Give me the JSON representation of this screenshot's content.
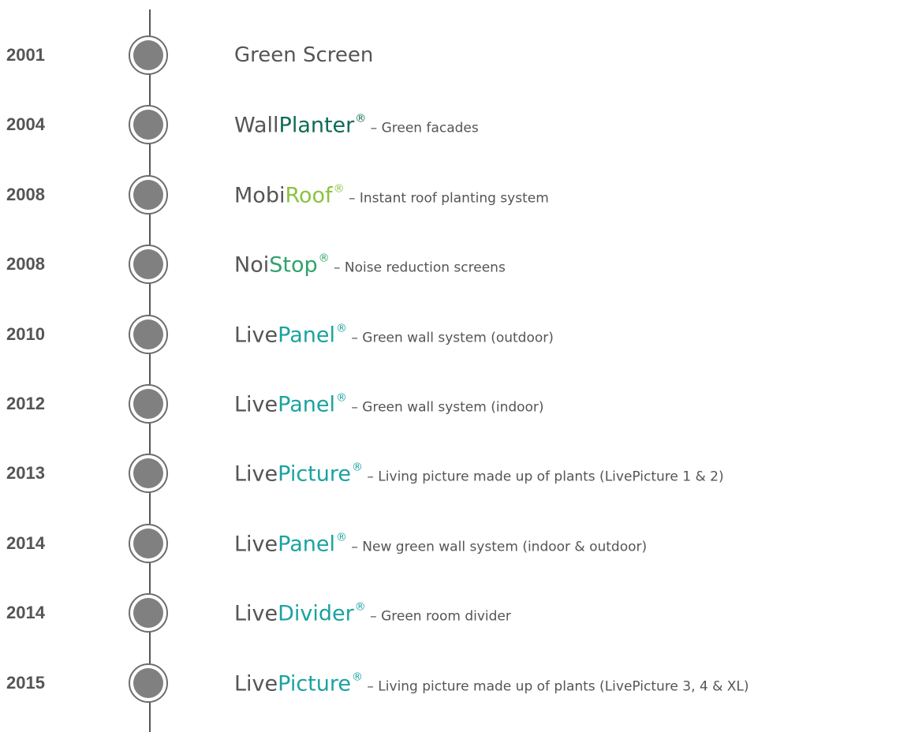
{
  "colors": {
    "dark_green": "#0e6c54",
    "lime_green": "#8ac43f",
    "green": "#2ea36a",
    "teal": "#1aa3a0",
    "gray_text": "#555555",
    "node_gray": "#808080"
  },
  "timeline": [
    {
      "year": "2001",
      "base": "Green Screen",
      "accent": "",
      "accent_color": "",
      "reg": "",
      "desc": ""
    },
    {
      "year": "2004",
      "base": "Wall",
      "accent": "Planter",
      "accent_color": "#0e6c54",
      "reg": "®",
      "desc": " – Green facades"
    },
    {
      "year": "2008",
      "base": "Mobi",
      "accent": "Roof",
      "accent_color": "#8ac43f",
      "reg": "®",
      "desc": " – Instant roof planting system"
    },
    {
      "year": "2008",
      "base": "Noi",
      "accent": "Stop",
      "accent_color": "#2ea36a",
      "reg": "®",
      "desc": " – Noise reduction screens"
    },
    {
      "year": "2010",
      "base": "Live",
      "accent": "Panel",
      "accent_color": "#1aa3a0",
      "reg": "®",
      "desc": " – Green wall system (outdoor)"
    },
    {
      "year": "2012",
      "base": "Live",
      "accent": "Panel",
      "accent_color": "#1aa3a0",
      "reg": "®",
      "desc": " – Green wall system (indoor)"
    },
    {
      "year": "2013",
      "base": "Live",
      "accent": "Picture",
      "accent_color": "#1aa3a0",
      "reg": "®",
      "desc": " – Living picture made up of plants (LivePicture 1 & 2)"
    },
    {
      "year": "2014",
      "base": "Live",
      "accent": "Panel",
      "accent_color": "#1aa3a0",
      "reg": "®",
      "desc": " – New green wall system (indoor & outdoor)"
    },
    {
      "year": "2014",
      "base": "Live",
      "accent": "Divider",
      "accent_color": "#1aa3a0",
      "reg": "®",
      "desc": " – Green room divider"
    },
    {
      "year": "2015",
      "base": "Live",
      "accent": "Picture",
      "accent_color": "#1aa3a0",
      "reg": "®",
      "desc": " – Living picture made up of plants (LivePicture 3, 4 & XL)"
    }
  ]
}
